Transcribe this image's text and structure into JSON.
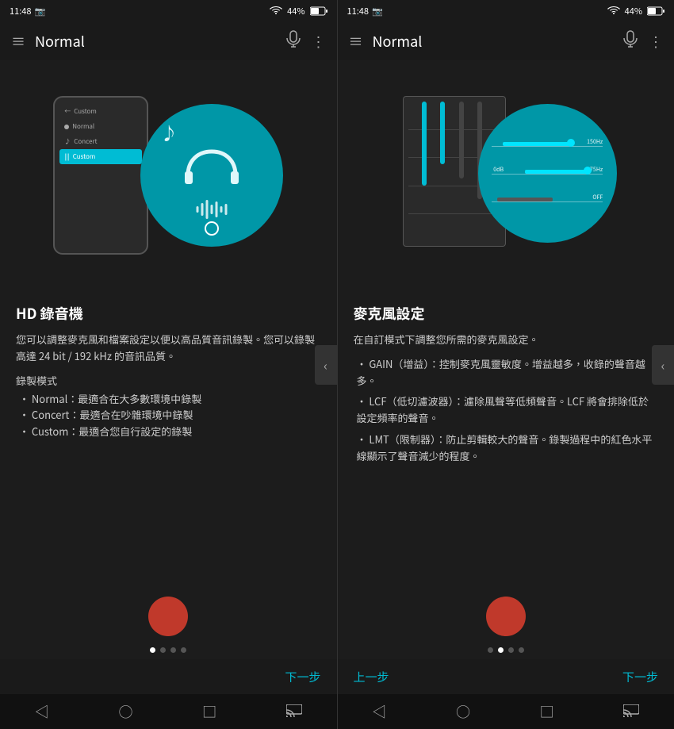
{
  "left_screen": {
    "status": {
      "time": "11:48",
      "battery": "44%",
      "wifi_signal": "▼▲",
      "notif_icon": "📷"
    },
    "nav": {
      "title": "Normal",
      "menu_icon": "≡",
      "mic_icon": "mic",
      "more_icon": "⋮"
    },
    "illustration": {
      "menu_items": [
        {
          "label": "Custom",
          "active": false,
          "icon": "←"
        },
        {
          "label": "Normal",
          "active": false,
          "icon": "♪"
        },
        {
          "label": "Concert",
          "active": false,
          "icon": "♪"
        },
        {
          "label": "Custom",
          "active": true,
          "icon": "|||"
        }
      ]
    },
    "text": {
      "title": "HD 錄音機",
      "body1": "您可以調整麥克風和檔案設定以便以高品質音訊錄製。您可以錄製高達 24 bit / 192 kHz 的音訊品質。",
      "subtitle": "錄製模式",
      "bullet1": "• Normal：最適合在大多數環境中錄製",
      "bullet2": "• Concert：最適合在吵雜環境中錄製",
      "bullet3": "• Custom：最適合您自行設定的錄製"
    },
    "indicators": [
      true,
      false,
      false,
      false
    ],
    "next_label": "下一步"
  },
  "right_screen": {
    "status": {
      "time": "11:48",
      "battery": "44%"
    },
    "nav": {
      "title": "Normal",
      "menu_icon": "≡",
      "mic_icon": "mic",
      "more_icon": "⋮"
    },
    "eq_labels": {
      "freq1": "150Hz",
      "freq2": "75Hz",
      "db1": "0dB",
      "db2": "0d",
      "off": "OFF"
    },
    "text": {
      "title": "麥克風設定",
      "body1": "在自訂模式下調整您所需的麥克風設定。",
      "bullet1": "• GAIN（增益）：控制麥克風靈敏度。增益越多，收錄的聲音越多。",
      "bullet2": "• LCF（低切濾波器）：濾除風聲等低頻聲音。LCF 將會排除低於設定頻率的聲音。",
      "bullet3": "• LMT（限制器）：防止剪輯較大的聲音。錄製過程中的紅色水平線顯示了聲音減少的程度。"
    },
    "indicators": [
      false,
      true,
      false,
      false
    ],
    "prev_label": "上一步",
    "next_label": "下一步"
  }
}
